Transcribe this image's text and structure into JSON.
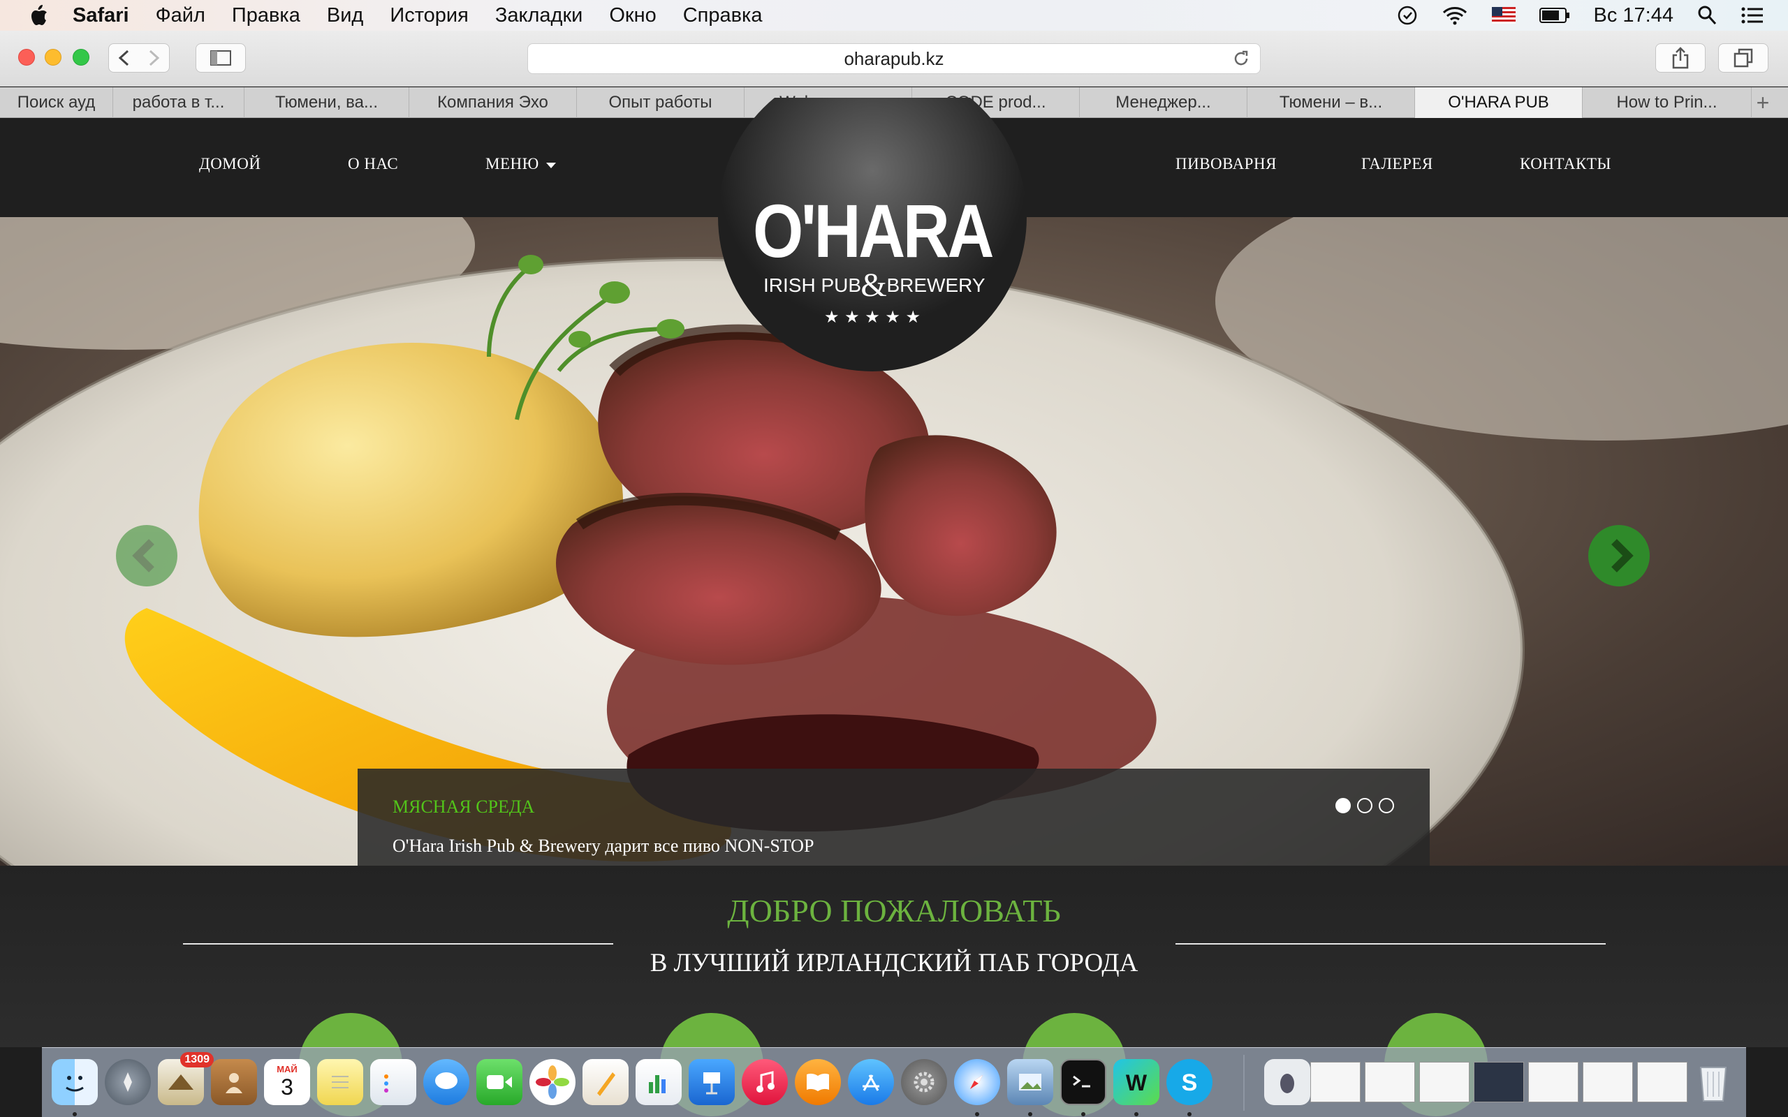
{
  "menubar": {
    "app": "Safari",
    "items": [
      "Файл",
      "Правка",
      "Вид",
      "История",
      "Закладки",
      "Окно",
      "Справка"
    ],
    "clock": "Вс 17:44"
  },
  "browser": {
    "url": "oharapub.kz",
    "tabs": [
      {
        "label": "Поиск ауд"
      },
      {
        "label": "работа в т..."
      },
      {
        "label": "Тюмени, ва..."
      },
      {
        "label": "Компания Эхо"
      },
      {
        "label": "Опыт работы"
      },
      {
        "label": "Web-прогр..."
      },
      {
        "label": "CODE prod..."
      },
      {
        "label": "Менеджер..."
      },
      {
        "label": "Тюмени – в..."
      },
      {
        "label": "O'HARA PUB",
        "active": true
      },
      {
        "label": "How to Prin..."
      }
    ]
  },
  "site": {
    "nav_left": [
      "ДОМОЙ",
      "О НАС",
      "МЕНЮ"
    ],
    "nav_right": [
      "ПИВОВАРНЯ",
      "ГАЛЕРЕЯ",
      "КОНТАКТЫ"
    ],
    "logo": {
      "name": "O'HARA",
      "sub_left": "IRISH PUB",
      "amp": "&",
      "sub_right": "BREWERY",
      "stars": "★ ★ ★ ★ ★"
    },
    "slide": {
      "title": "МЯСНАЯ СРЕДА",
      "text": "O'Hara Irish Pub & Brewery дарит все пиво NON-STOP",
      "current": 1,
      "total": 3
    },
    "welcome_title": "ДОБРО ПОЖАЛОВАТЬ",
    "welcome_subtitle": "В ЛУЧШИЙ ИРЛАНДСКИЙ ПАБ ГОРОДА"
  },
  "dock": {
    "mail_badge": "1309",
    "calendar_month": "МАЙ",
    "calendar_day": "3"
  },
  "colors": {
    "accent_green": "#6cb33f",
    "caption_title": "#52c41a",
    "header_bg": "#1f1f1f"
  }
}
